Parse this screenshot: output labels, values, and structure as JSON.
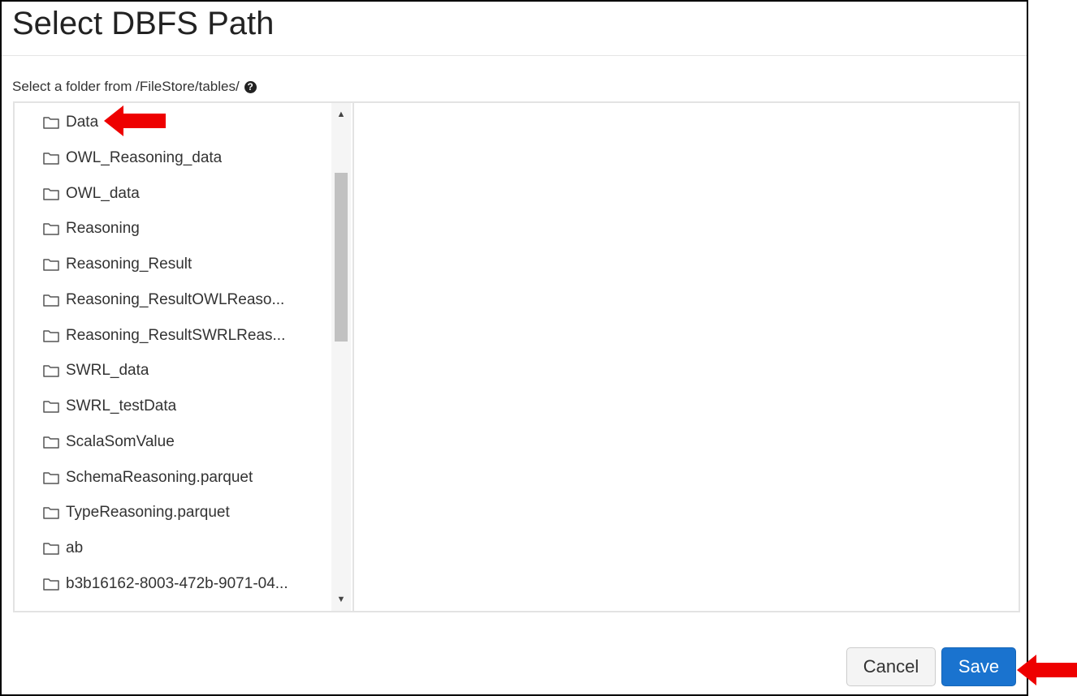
{
  "dialog": {
    "title": "Select DBFS Path",
    "instruction": "Select a folder from /FileStore/tables/",
    "help_icon": "question-circle-icon"
  },
  "folders": [
    {
      "label": "Data"
    },
    {
      "label": "OWL_Reasoning_data"
    },
    {
      "label": "OWL_data"
    },
    {
      "label": "Reasoning"
    },
    {
      "label": "Reasoning_Result"
    },
    {
      "label": "Reasoning_ResultOWLReaso..."
    },
    {
      "label": "Reasoning_ResultSWRLReas..."
    },
    {
      "label": "SWRL_data"
    },
    {
      "label": "SWRL_testData"
    },
    {
      "label": "ScalaSomValue"
    },
    {
      "label": "SchemaReasoning.parquet"
    },
    {
      "label": "TypeReasoning.parquet"
    },
    {
      "label": "ab"
    },
    {
      "label": "b3b16162-8003-472b-9071-04..."
    }
  ],
  "footer": {
    "cancel_label": "Cancel",
    "save_label": "Save"
  },
  "colors": {
    "primary_button": "#1a73cf",
    "annotation_arrow": "#ee0000"
  }
}
